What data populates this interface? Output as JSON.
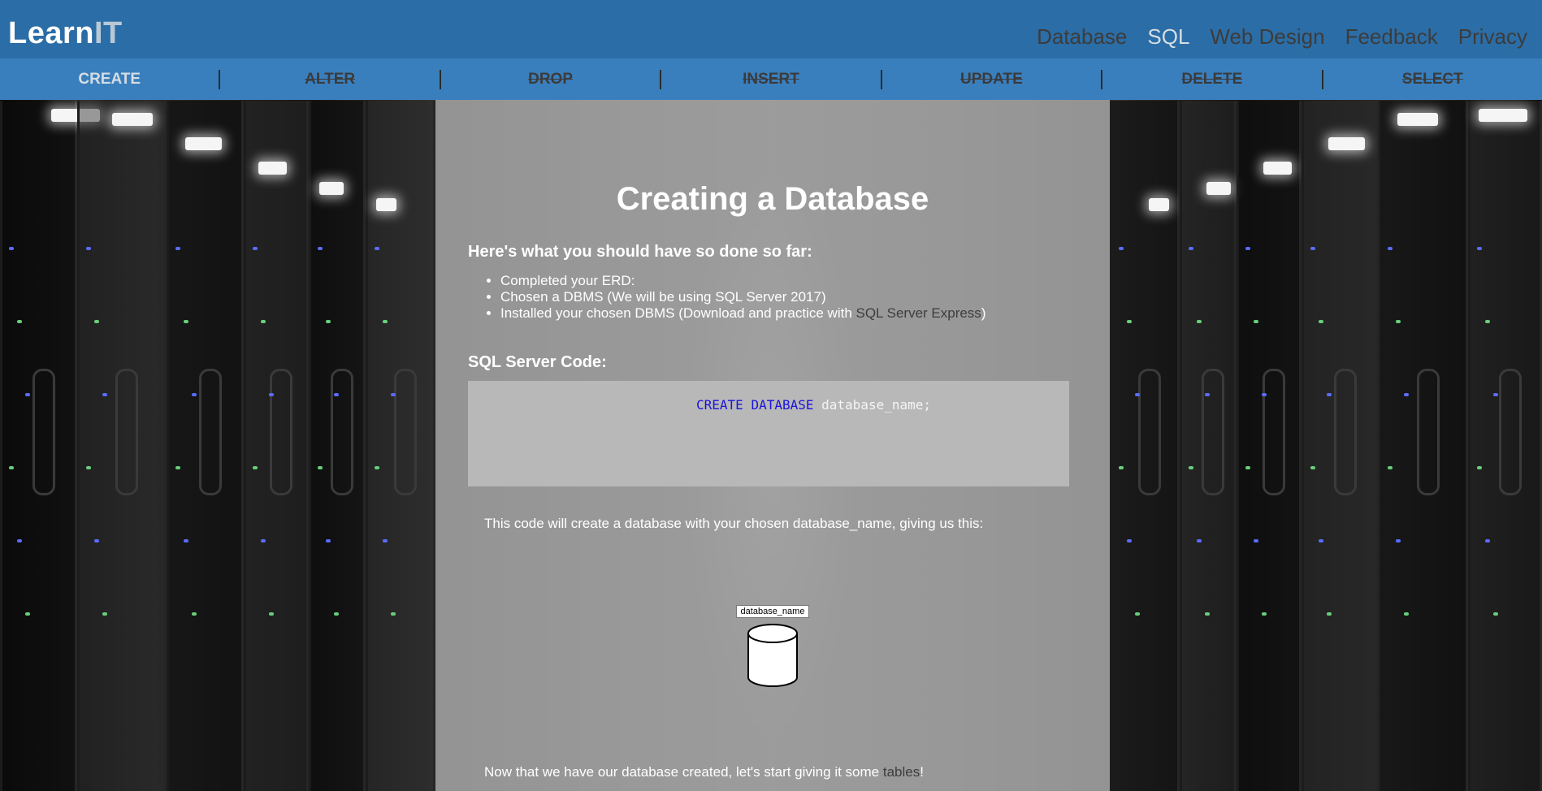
{
  "header": {
    "logo_main": "Learn",
    "logo_accent": "IT",
    "nav": [
      {
        "label": "Database"
      },
      {
        "label": "SQL"
      },
      {
        "label": "Web Design"
      },
      {
        "label": "Feedback"
      },
      {
        "label": "Privacy"
      }
    ],
    "active_nav": "SQL"
  },
  "subnav": {
    "items": [
      {
        "label": "CREATE"
      },
      {
        "label": "ALTER"
      },
      {
        "label": "DROP"
      },
      {
        "label": "INSERT"
      },
      {
        "label": "UPDATE"
      },
      {
        "label": "DELETE"
      },
      {
        "label": "SELECT"
      }
    ],
    "active": "CREATE"
  },
  "main": {
    "title": "Creating a Database",
    "done_heading": "Here's what you should have so done so far:",
    "checklist": {
      "item1": "Completed your ERD:",
      "item2": "Chosen a DBMS (We will be using SQL Server 2017)",
      "item3_prefix": "Installed your chosen DBMS (Download and practice with ",
      "item3_link": "SQL Server Express",
      "item3_suffix": ")"
    },
    "code_heading": "SQL Server Code:",
    "code": {
      "kw1": "CREATE",
      "kw2": "DATABASE",
      "rest": "database_name;"
    },
    "explanation": "This code will create a database with your chosen database_name, giving us this:",
    "diagram_label": "database_name",
    "closing_prefix": "Now that we have our database created, let's start giving it some ",
    "closing_link": "tables",
    "closing_suffix": "!"
  },
  "colors": {
    "header_bg": "#2b6da6",
    "subnav_bg": "#3a7fbd",
    "panel_bg": "#a5a5a5",
    "code_bg": "#b8b8b8",
    "keyword": "#1a13d8",
    "link": "#3d3d3d"
  },
  "icons": {
    "diagram": "database-cylinder-icon"
  }
}
